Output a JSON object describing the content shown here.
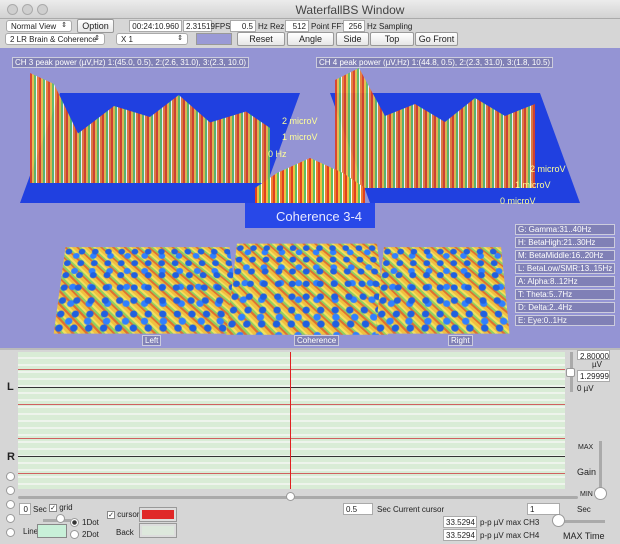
{
  "window": {
    "title": "WaterfallBS Window"
  },
  "toolbar": {
    "view_select": "Normal View",
    "option": "Option",
    "time": "00:24:10.960",
    "fps_value": "2.31519",
    "fps_label": "FPS",
    "hz_rez_value": "0.5",
    "hz_rez_label": "Hz Rez",
    "fft_value": "512",
    "fft_label": "Point FFT",
    "sampling_value": "256",
    "sampling_label": "Hz Sampling",
    "mode_select": "2 LR Brain & Coherence",
    "scale_select": "X 1",
    "color_swatch": "#9a9ad6",
    "reset": "Reset",
    "angle": "Angle",
    "side": "Side",
    "top": "Top",
    "go_front": "Go Front"
  },
  "view3d": {
    "ch3_peak": "CH 3 peak power (µV,Hz) 1:(45.0, 0.5), 2:(2.6, 31.0), 3:(2.3, 10.0)",
    "ch4_peak": "CH 4 peak power (µV,Hz) 1:(44.8, 0.5), 2:(2.3, 31.0), 3:(1.8, 10.5)",
    "left_scale": [
      "2 microV",
      "1 microV",
      "0 Hz"
    ],
    "right_scale": [
      "2 microV",
      "1 microV",
      "0 microV"
    ],
    "coherence_title": "Coherence 3-4",
    "bands": [
      "G: Gamma:31..40Hz",
      "H: BetaHigh:21..30Hz",
      "M: BetaMiddle:16..20Hz",
      "L: BetaLow/SMR:13..15Hz",
      "A: Alpha:8..12Hz",
      "T: Theta:5..7Hz",
      "D: Delta:2..4Hz",
      "E: Eye:0..1Hz"
    ],
    "panel_labels": {
      "left": "Left",
      "coherence": "Coherence",
      "right": "Right"
    },
    "background": "#9494d4"
  },
  "graph": {
    "left_label": "L",
    "right_label": "R",
    "max_uv": "2.80000",
    "uv_unit": "µV",
    "current_uv": "1.29999",
    "zero_uv": "0 µV",
    "cursor_color": "#e02020"
  },
  "gain": {
    "max": "MAX",
    "label": "Gain",
    "min": "MIN"
  },
  "bottom": {
    "start_sec": "0",
    "sec": "Sec",
    "grid": "grid",
    "grid_checked": true,
    "cursor": "cursor",
    "cursor_checked": true,
    "cursor_color": "#e02828",
    "line": "Line",
    "line_color": "#c8f0d8",
    "dot1": "1Dot",
    "dot2": "2Dot",
    "dot_selected": "1Dot",
    "back": "Back",
    "back_color": "#dde8dc",
    "current_cursor_value": "0.5",
    "current_cursor_label": "Sec Current cursor",
    "end_sec": "1",
    "end_sec_label": "Sec",
    "max_ch3": "33.5294",
    "max_ch3_label": "p-p µV max CH3",
    "max_ch4": "33.5294",
    "max_ch4_label": "p-p µV max CH4",
    "max_time": "MAX Time"
  }
}
